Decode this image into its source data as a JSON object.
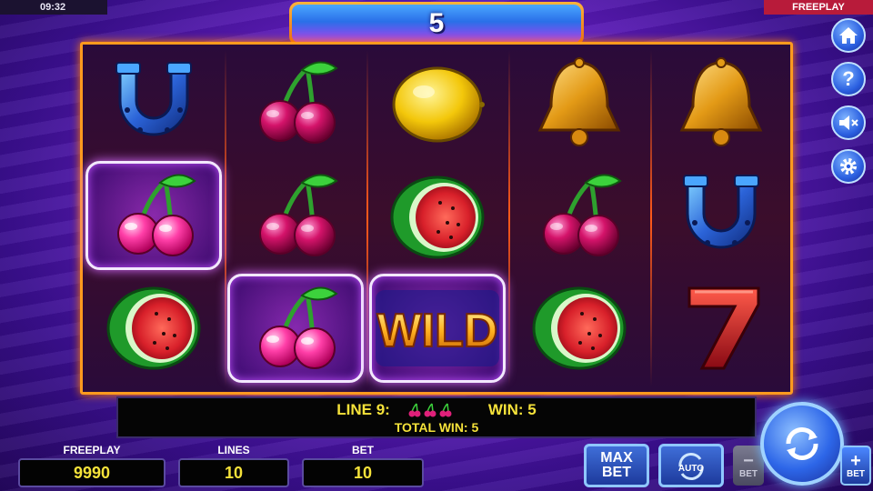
{
  "status_bar": {
    "clock": "09:32",
    "mode": "FREEPLAY"
  },
  "counter": {
    "value": "5"
  },
  "reels": [
    [
      "horseshoe-icon",
      "cherries-icon",
      "watermelon-icon"
    ],
    [
      "cherries-icon",
      "cherries-icon",
      "cherries-icon"
    ],
    [
      "lemon-icon",
      "watermelon-icon",
      "wild-icon"
    ],
    [
      "bell-icon",
      "cherries-icon",
      "watermelon-icon"
    ],
    [
      "bell-icon",
      "horseshoe-icon",
      "seven-icon"
    ]
  ],
  "winning_positions": [
    "reel1-row2",
    "reel2-row3",
    "reel3-row3"
  ],
  "wild_text": "WILD",
  "win_panel": {
    "line_label": "LINE 9:",
    "win_label": "WIN: 5",
    "total_label": "TOTAL WIN: 5",
    "line_symbols": [
      "cherries-icon",
      "cherries-icon",
      "cherries-icon"
    ]
  },
  "stats": {
    "balance_label": "FREEPLAY",
    "balance_value": "9990",
    "lines_label": "LINES",
    "lines_value": "10",
    "bet_label": "BET",
    "bet_value": "10"
  },
  "buttons": {
    "max_bet_top": "MAX",
    "max_bet_bottom": "BET",
    "auto_label": "AUTO",
    "bet_minus_label": "BET",
    "bet_plus_label": "BET"
  },
  "side_buttons": [
    "home-icon",
    "help-icon",
    "sound-muted-icon",
    "settings-icon"
  ],
  "colors": {
    "frame_orange": "#ff9a1e",
    "win_text_yellow": "#f5e23a",
    "button_blue": "#2d66e8",
    "freeplay_red": "#b81b3a"
  }
}
